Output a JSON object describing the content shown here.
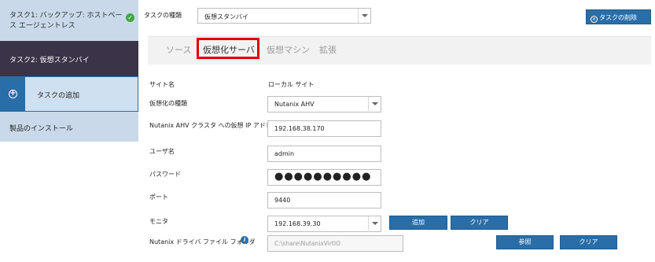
{
  "sidebar": {
    "task1": "タスク1: バックアップ: ホストベース エージェントレス",
    "task2": "タスク2: 仮想スタンバイ",
    "add_task": "タスクの追加",
    "install": "製品のインストール"
  },
  "header": {
    "task_type_label": "タスクの種類",
    "task_type_value": "仮想スタンバイ",
    "delete_task_button": "タスクの削除"
  },
  "tabs": [
    {
      "label": "ソース"
    },
    {
      "label": "仮想化サーバ"
    },
    {
      "label": "仮想マシン"
    },
    {
      "label": "拡張"
    }
  ],
  "active_tab": "仮想化サーバ",
  "form": {
    "site_label": "サイト名",
    "site_value": "ローカル サイト",
    "virt_type_label": "仮想化の種類",
    "virt_type_value": "Nutanix AHV",
    "cluster_ip_label": "Nutanix AHV クラスタ への仮想 IP アドレス",
    "cluster_ip_value": "192.168.38.170",
    "username_label": "ユーザ名",
    "username_value": "admin",
    "password_label": "パスワード",
    "password_value": "●●●●●●●●●●",
    "port_label": "ポート",
    "port_value": "9440",
    "monitor_label": "モニタ",
    "monitor_value": "192.168.39.30",
    "add_button": "追加",
    "clear_button": "クリア",
    "driver_folder_label": "Nutanix ドライバ ファイル フォルダ",
    "driver_folder_value": "C:\\share\\NutanixVirtIO",
    "browse_button": "参照",
    "clear_button2": "クリア"
  },
  "colors": {
    "accent": "#2a6ea8",
    "highlight": "#e00000",
    "sidebar_active": "#3b3347",
    "sidebar_bg": "#c9d9ea"
  }
}
